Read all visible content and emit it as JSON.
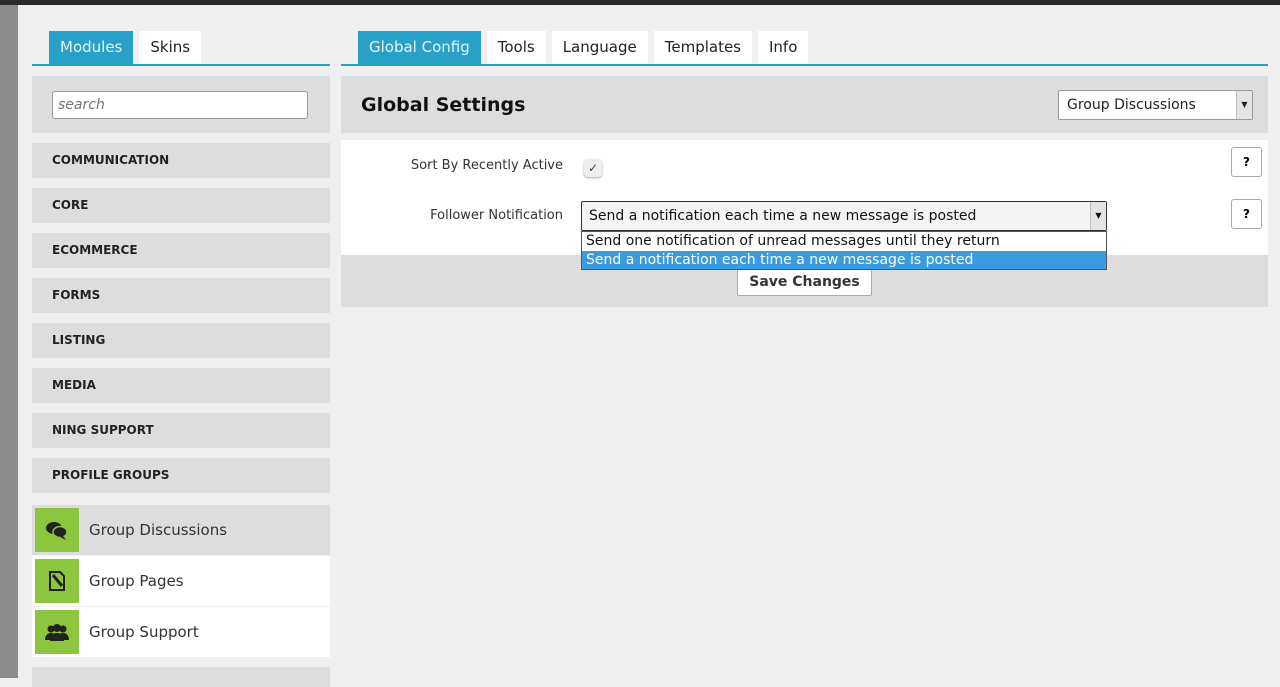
{
  "left_tabs": [
    {
      "label": "Modules",
      "active": true
    },
    {
      "label": "Skins",
      "active": false
    }
  ],
  "right_tabs": [
    {
      "label": "Global Config",
      "active": true
    },
    {
      "label": "Tools"
    },
    {
      "label": "Language"
    },
    {
      "label": "Templates"
    },
    {
      "label": "Info"
    }
  ],
  "search": {
    "placeholder": "search"
  },
  "categories": [
    "COMMUNICATION",
    "CORE",
    "ECOMMERCE",
    "FORMS",
    "LISTING",
    "MEDIA",
    "NING SUPPORT",
    "PROFILE GROUPS"
  ],
  "modules": [
    {
      "label": "Group Discussions",
      "icon": "chat-bubbles-icon",
      "selected": true
    },
    {
      "label": "Group Pages",
      "icon": "page-edit-icon"
    },
    {
      "label": "Group Support",
      "icon": "users-group-icon"
    }
  ],
  "main": {
    "title": "Global Settings",
    "module_select": "Group Discussions"
  },
  "settings": {
    "sort_label": "Sort By Recently Active",
    "sort_checked": true,
    "follower_label": "Follower Notification",
    "follower_value": "Send a notification each time a new message is posted",
    "follower_options": [
      "Send one notification of unread messages until they return",
      "Send a notification each time a new message is posted"
    ],
    "help": "?"
  },
  "save_label": "Save Changes",
  "colors": {
    "accent": "#28a0c8",
    "module_icon": "#8cc63f",
    "highlight": "#3a9be0"
  }
}
